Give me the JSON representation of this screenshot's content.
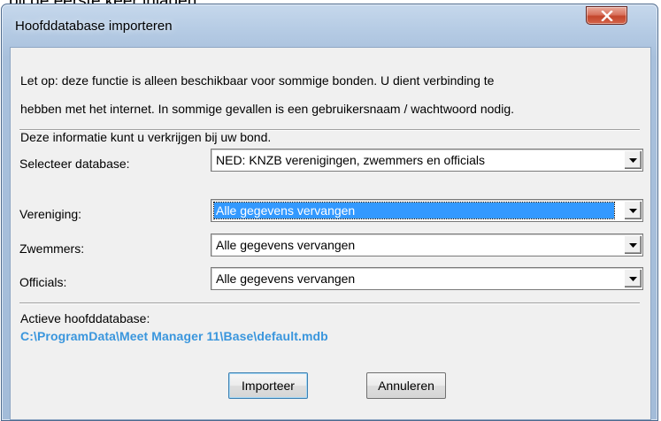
{
  "page_caption": "bij de eerste keer inladen.",
  "dialog": {
    "title": "Hoofddatabase importeren",
    "close_icon": "close-x-icon",
    "notice_lines": [
      "Let op: deze functie is alleen beschikbaar voor sommige bonden. U dient verbinding te",
      "hebben met het internet. In sommige gevallen is een gebruikersnaam / wachtwoord nodig.",
      "Deze informatie kunt u verkrijgen bij uw bond."
    ],
    "database": {
      "label": "Selecteer database:",
      "value": "NED: KNZB verenigingen, zwemmers en officials"
    },
    "vereniging": {
      "label": "Vereniging:",
      "value": "Alle gegevens vervangen"
    },
    "zwemmers": {
      "label": "Zwemmers:",
      "value": "Alle gegevens vervangen"
    },
    "officials": {
      "label": "Officials:",
      "value": "Alle gegevens vervangen"
    },
    "active_db": {
      "label": "Actieve hoofddatabase:",
      "path": "C:\\ProgramData\\Meet Manager 11\\Base\\default.mdb"
    },
    "buttons": {
      "import": "Importeer",
      "cancel": "Annuleren"
    }
  },
  "colors": {
    "selection": "#3399ff",
    "path": "#3a96dd",
    "close_button": "#c3452b"
  }
}
